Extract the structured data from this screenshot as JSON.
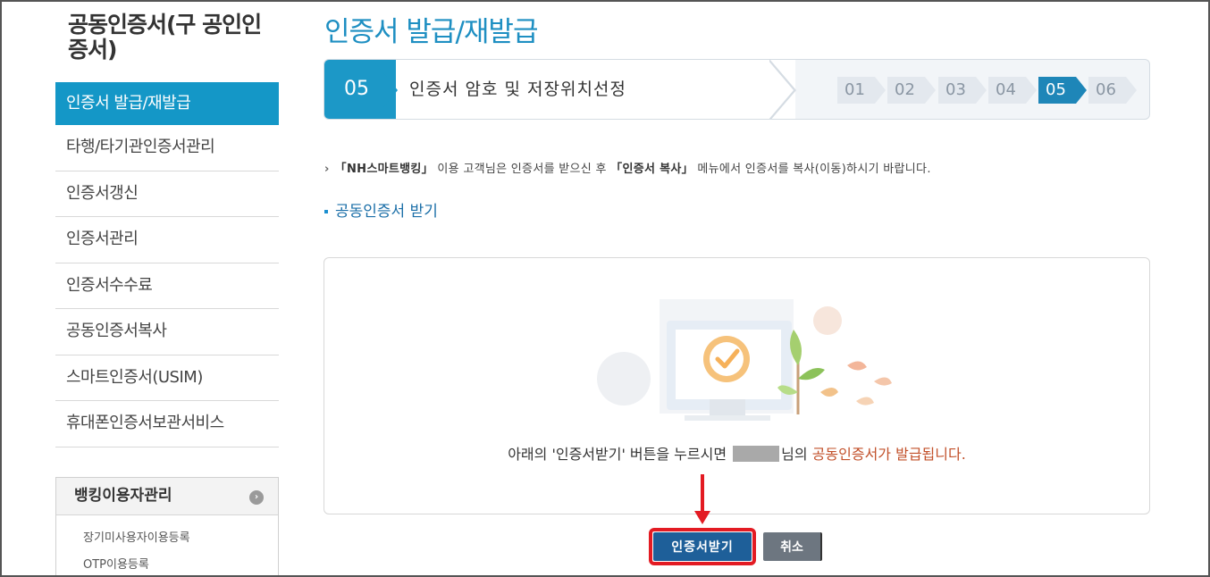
{
  "sidebar": {
    "title": "공동인증서(구 공인인증서)",
    "menu": [
      {
        "label": "인증서 발급/재발급",
        "active": true
      },
      {
        "label": "타행/타기관인증서관리"
      },
      {
        "label": "인증서갱신"
      },
      {
        "label": "인증서관리"
      },
      {
        "label": "인증서수수료"
      },
      {
        "label": "공동인증서복사"
      },
      {
        "label": "스마트인증서(USIM)"
      },
      {
        "label": "휴대폰인증서보관서비스"
      }
    ],
    "box": {
      "title": "뱅킹이용자관리",
      "items": [
        "장기미사용자이용등록",
        "OTP이용등록"
      ]
    }
  },
  "main": {
    "title": "인증서 발급/재발급",
    "step": {
      "current_num": "05",
      "current_label": "인증서 암호 및 저장위치선정",
      "chips": [
        "01",
        "02",
        "03",
        "04",
        "05",
        "06"
      ],
      "active_index": 4
    },
    "notice": {
      "prefix": "「NH스마트뱅킹」",
      "text1": " 이용 고객님은 인증서를 받으신 후 ",
      "bold2": "「인증서 복사」",
      "text2": " 메뉴에서 인증서를 복사(이동)하시기 바랍니다."
    },
    "section_title": "공동인증서 받기",
    "message": {
      "before": "아래의 '인증서받기' 버튼을 누르시면 ",
      "after": "님의 ",
      "highlight": "공동인증서가 발급됩니다."
    },
    "buttons": {
      "receive": "인증서받기",
      "cancel": "취소"
    }
  },
  "colors": {
    "accent": "#1497c7",
    "highlight": "#c2502a",
    "annotation": "#e31b23"
  }
}
